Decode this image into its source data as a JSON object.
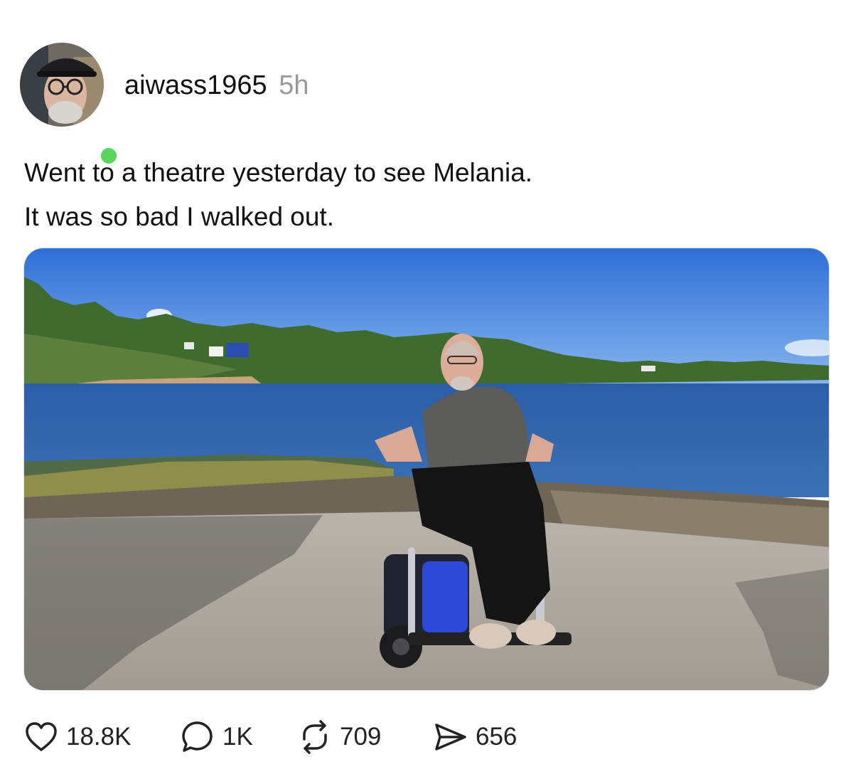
{
  "post": {
    "author": {
      "username": "aiwass1965",
      "avatar_icon": "avatar-photo",
      "online_status_color": "#5bd45b"
    },
    "timestamp": "5h",
    "text_lines": [
      "Went to a theatre yesterday to see Melania.",
      "It was so bad I walked out."
    ],
    "media": {
      "type": "photo"
    },
    "actions": {
      "like": {
        "icon": "heart-icon",
        "count": "18.8K"
      },
      "reply": {
        "icon": "comment-icon",
        "count": "1K"
      },
      "repost": {
        "icon": "repost-icon",
        "count": "709"
      },
      "share": {
        "icon": "send-icon",
        "count": "656"
      }
    }
  }
}
